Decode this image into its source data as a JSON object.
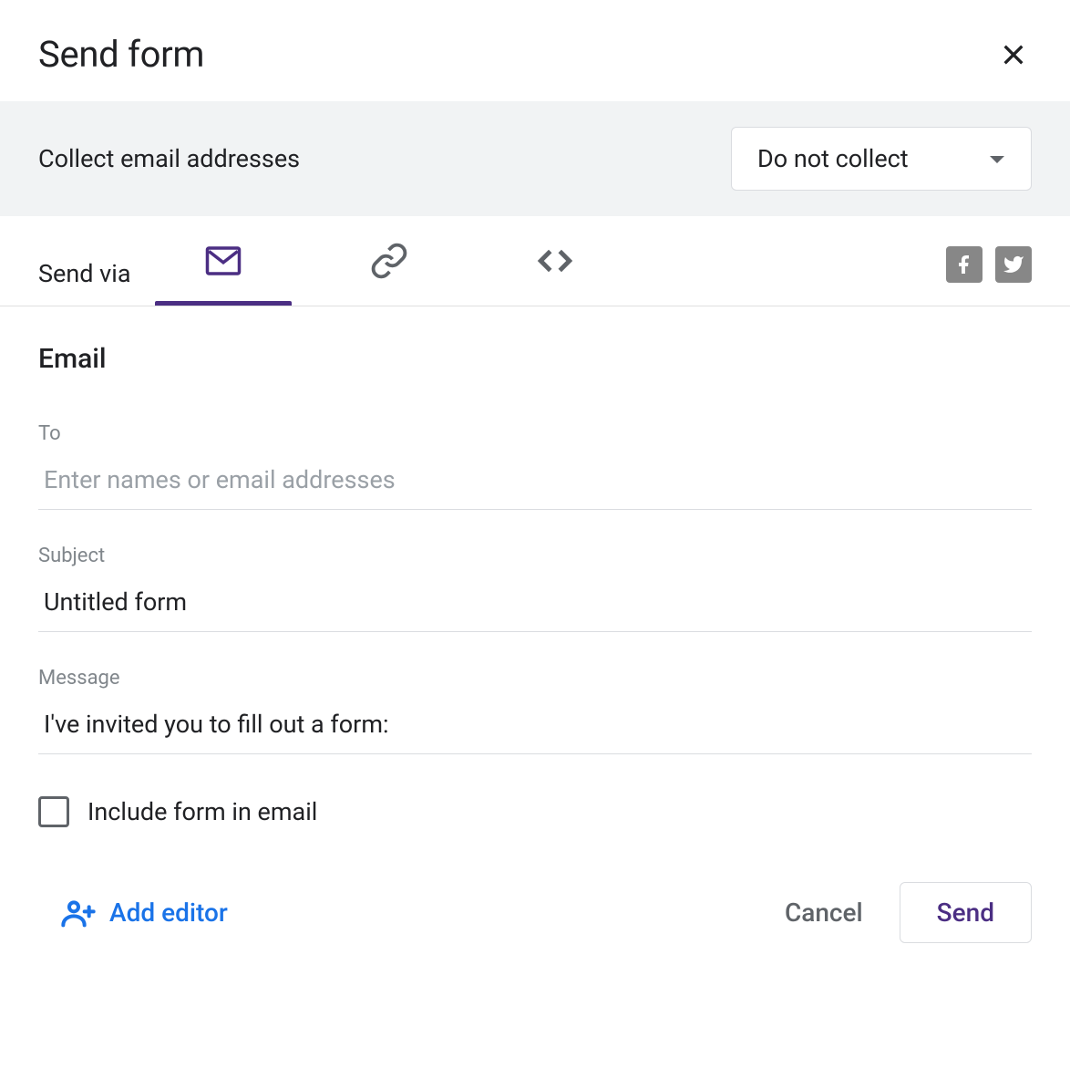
{
  "dialog": {
    "title": "Send form"
  },
  "collect": {
    "label": "Collect email addresses",
    "selected": "Do not collect"
  },
  "tabs": {
    "label": "Send via"
  },
  "email": {
    "title": "Email",
    "to_label": "To",
    "to_placeholder": "Enter names or email addresses",
    "to_value": "",
    "subject_label": "Subject",
    "subject_value": "Untitled form",
    "message_label": "Message",
    "message_value": "I've invited you to fill out a form:",
    "include_label": "Include form in email"
  },
  "footer": {
    "add_editor": "Add editor",
    "cancel": "Cancel",
    "send": "Send"
  }
}
